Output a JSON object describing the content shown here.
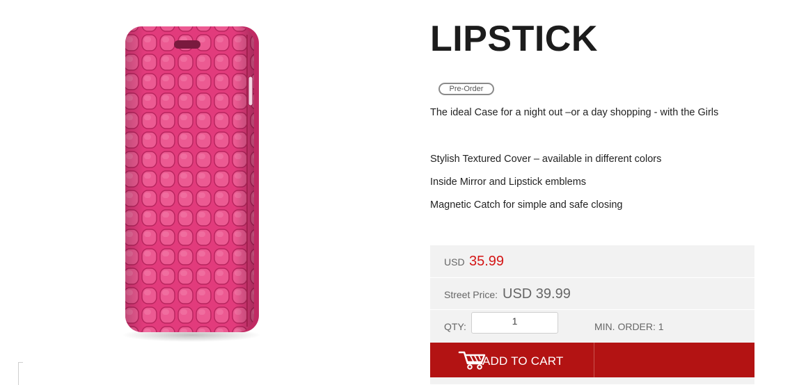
{
  "product": {
    "title": "LIPSTICK",
    "badge": "Pre-Order",
    "description": "The ideal Case for a night out –or a day shopping - with the Girls",
    "features": [
      "Stylish Textured Cover – available in different colors",
      "Inside Mirror  and Lipstick emblems",
      "Magnetic Catch for simple and safe closing"
    ],
    "image_icon": "phone-case-image",
    "case_color": "#e23b7c"
  },
  "pricing": {
    "currency_label": "USD",
    "price": "35.99",
    "price_color": "#d41616",
    "street_label": "Street Price:",
    "street_value": "USD 39.99"
  },
  "order": {
    "qty_label": "QTY:",
    "qty_value": "1",
    "min_order": "MIN. ORDER: 1",
    "add_to_cart_label": "ADD TO CART",
    "add_to_cart_color": "#b31313",
    "cart_icon": "shopping-cart-icon"
  }
}
